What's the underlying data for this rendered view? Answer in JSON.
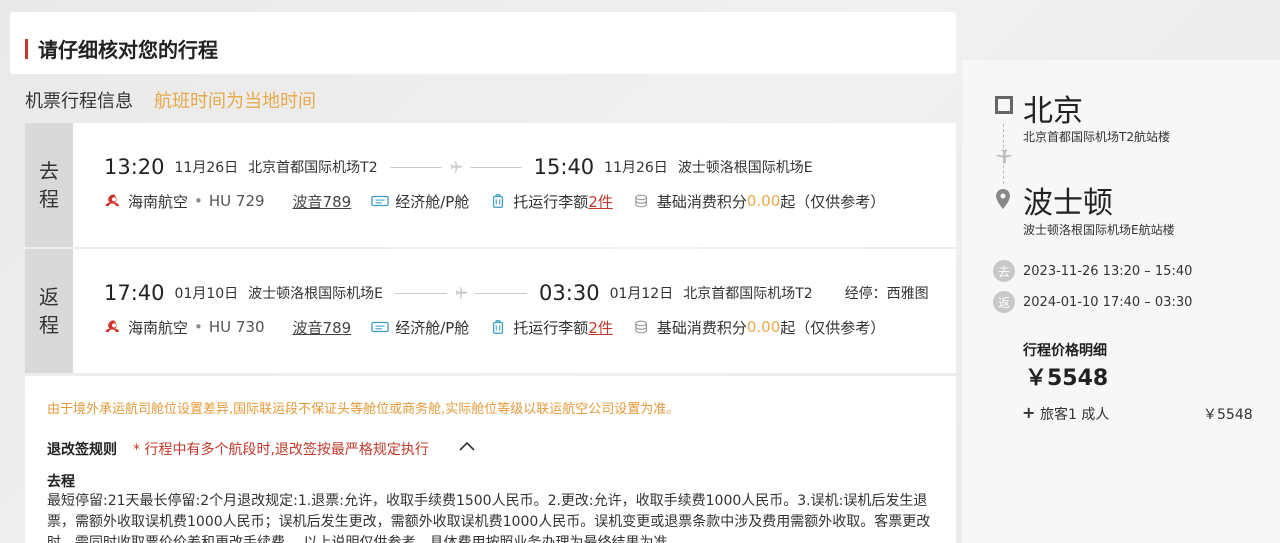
{
  "header": {
    "title": "请仔细核对您的行程"
  },
  "section": {
    "title": "机票行程信息",
    "note": "航班时间为当地时间"
  },
  "outbound": {
    "dir1": "去",
    "dir2": "程",
    "dep_time": "13:20",
    "dep_date": "11月26日",
    "dep_airport": "北京首都国际机场T2",
    "arr_time": "15:40",
    "arr_date": "11月26日",
    "arr_airport": "波士顿洛根国际机场E",
    "airline": "海南航空",
    "flight_no": "HU 729",
    "aircraft": "波音789",
    "cabin": "经济舱/P舱",
    "baggage_prefix": "托运行李额",
    "baggage_count": "2件",
    "points_prefix": "基础消费积分",
    "points_value": "0.00",
    "points_suffix": "起（仅供参考）"
  },
  "return": {
    "dir1": "返",
    "dir2": "程",
    "dep_time": "17:40",
    "dep_date": "01月10日",
    "dep_airport": "波士顿洛根国际机场E",
    "arr_time": "03:30",
    "arr_date": "01月12日",
    "arr_airport": "北京首都国际机场T2",
    "stop": "经停：西雅图",
    "airline": "海南航空",
    "flight_no": "HU 730",
    "aircraft": "波音789",
    "cabin": "经济舱/P舱",
    "baggage_prefix": "托运行李额",
    "baggage_count": "2件",
    "points_prefix": "基础消费积分",
    "points_value": "0.00",
    "points_suffix": "起（仅供参考）"
  },
  "rules": {
    "warning": "由于境外承运航司舱位设置差异,国际联运段不保证头等舱位或商务舱,实际舱位等级以联运航空公司设置为准。",
    "head": "退改签规则",
    "note": "* 行程中有多个航段时,退改签按最严格规定执行",
    "segment_title": "去程",
    "text": "最短停留:21天最长停留:2个月退改规定:1.退票:允许，收取手续费1500人民币。2.更改:允许，收取手续费1000人民币。3.误机:误机后发生退票，需额外收取误机费1000人民币；误机后发生更改，需额外收取误机费1000人民币。误机变更或退票条款中涉及费用需额外收取。客票更改时，需同时收取票价价差和更改手续费。 以上说明仅供参考，具体费用按照业务办理为最终结果为准。"
  },
  "summary": {
    "from_city": "北京",
    "from_airport": "北京首都国际机场T2航站楼",
    "to_city": "波士顿",
    "to_airport": "波士顿洛根国际机场E航站楼",
    "out_badge": "去",
    "out_text": "2023-11-26   13:20  –  15:40",
    "ret_badge": "返",
    "ret_text": "2024-01-10   17:40  –  03:30",
    "price_title": "行程价格明细",
    "price_total": "￥5548",
    "pax_label": "旅客1   成人",
    "pax_price": "￥5548"
  },
  "colors": {
    "accent": "#c23a2b",
    "orange": "#e8a94a"
  }
}
